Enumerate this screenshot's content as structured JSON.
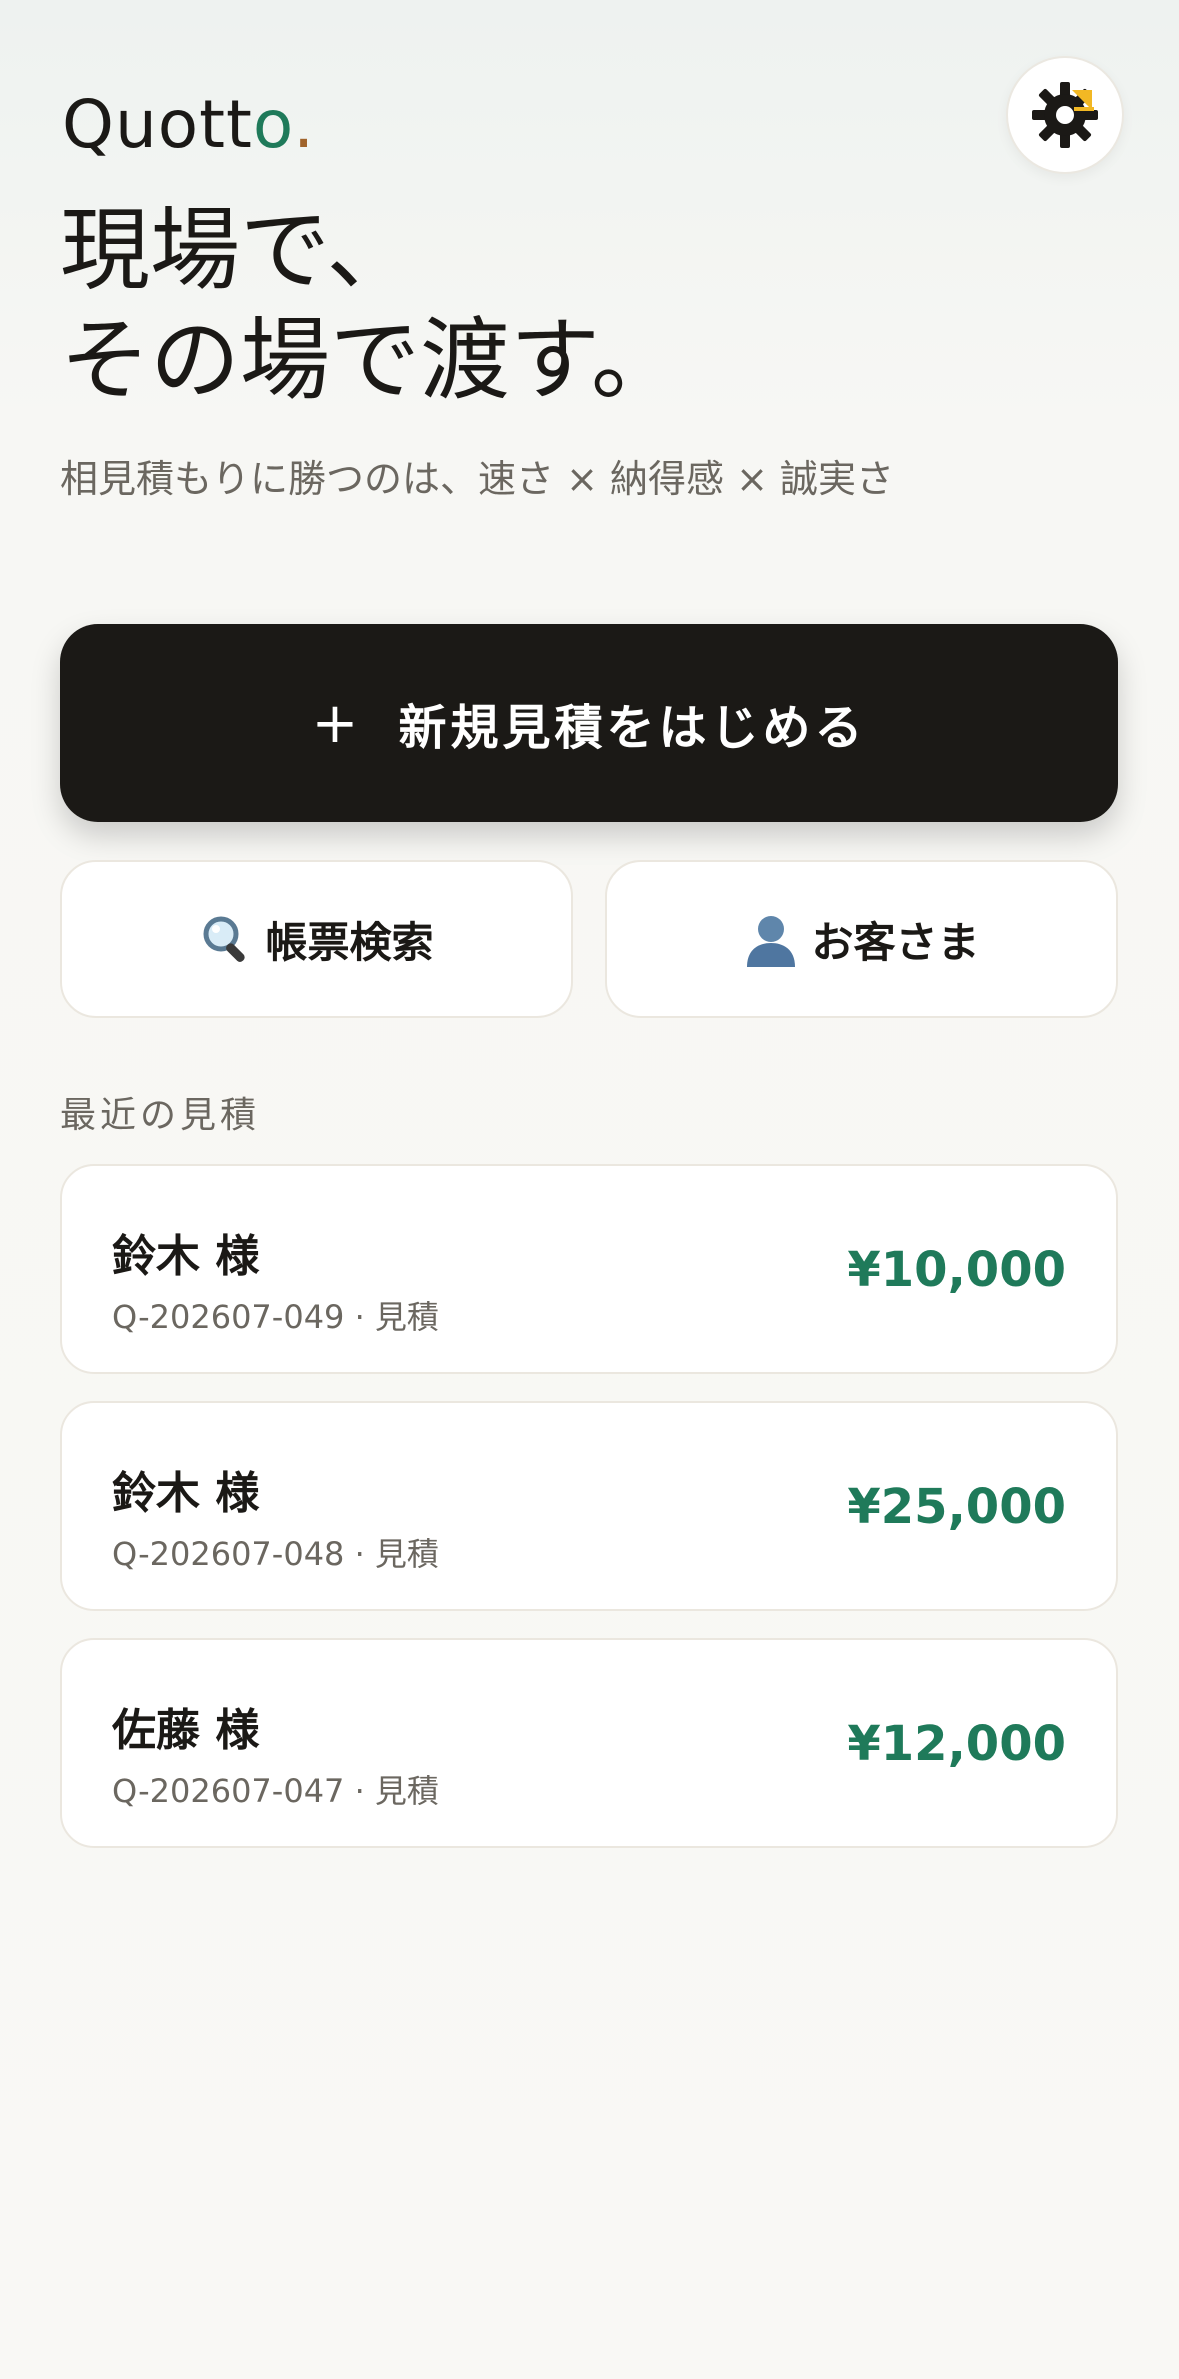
{
  "brand": {
    "logo_main": "Quott",
    "logo_accent": "o",
    "logo_dot": "."
  },
  "header": {
    "settings_icon": "settings-gear-icon"
  },
  "hero": {
    "title_line1": "現場で、",
    "title_line2": "その場で渡す。",
    "subtitle": "相見積もりに勝つのは、速さ × 納得感 × 誠実さ"
  },
  "actions": {
    "new_quote_plus": "+",
    "new_quote_label": "新規見積をはじめる",
    "search_icon": "magnifier-icon",
    "search_label": "帳票検索",
    "customers_icon": "person-icon",
    "customers_label": "お客さま"
  },
  "recent": {
    "label": "最近の見積",
    "items": [
      {
        "name": "鈴木 様",
        "meta": "Q-202607-049 · 見積",
        "amount": "¥10,000"
      },
      {
        "name": "鈴木 様",
        "meta": "Q-202607-048 · 見積",
        "amount": "¥25,000"
      },
      {
        "name": "佐藤 様",
        "meta": "Q-202607-047 · 見積",
        "amount": "¥12,000"
      }
    ]
  },
  "colors": {
    "accent_green": "#1f7a5a",
    "accent_brown": "#a0632b",
    "dark": "#1b1916",
    "sun_yellow": "#f2b824"
  }
}
